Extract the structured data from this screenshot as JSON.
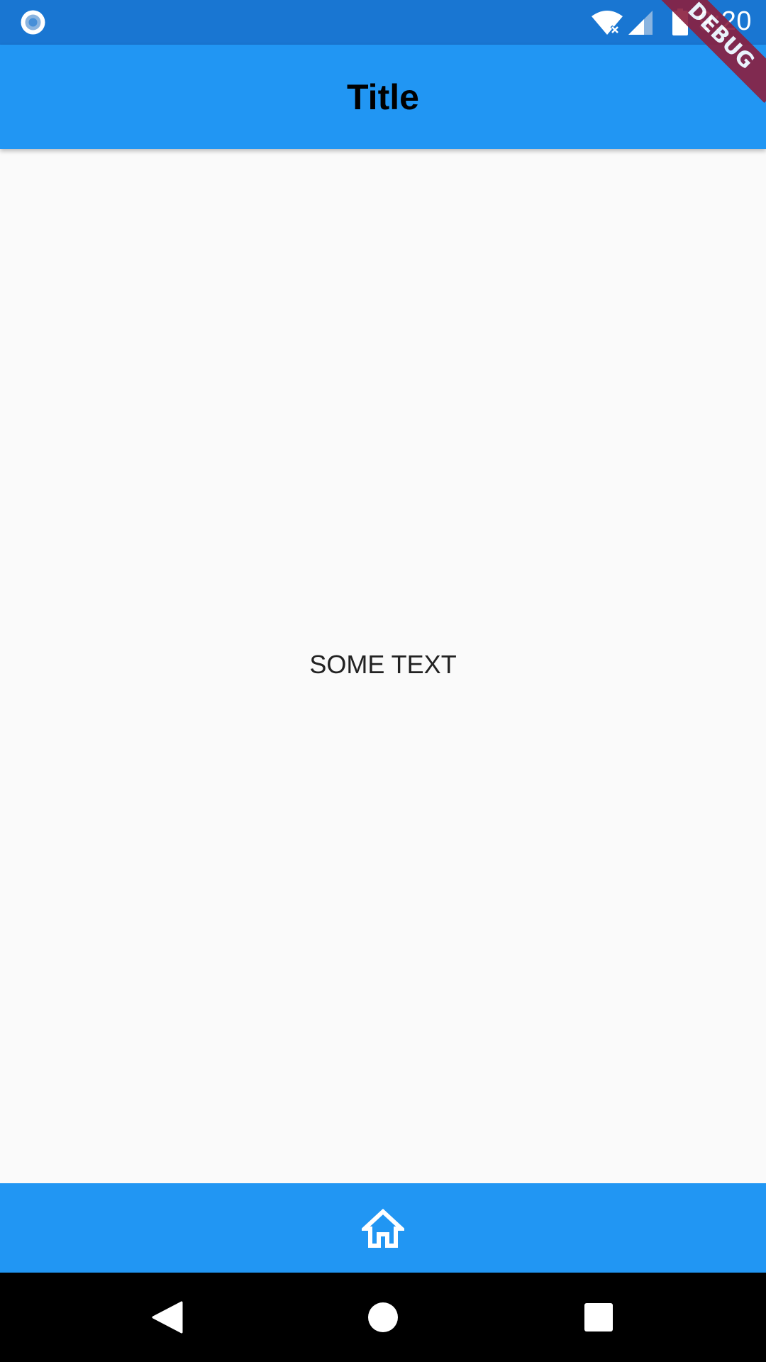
{
  "status_bar": {
    "time": "9:20",
    "icons": [
      "record-icon",
      "wifi-icon",
      "cell-signal-icon",
      "battery-icon"
    ]
  },
  "debug_banner": {
    "label": "DEBUG"
  },
  "app_bar": {
    "title": "Title"
  },
  "main": {
    "text": "SOME TEXT"
  },
  "bottom_bar": {
    "items": [
      {
        "icon": "home-icon"
      }
    ]
  },
  "nav_bar": {
    "icons": [
      "back-icon",
      "home-icon",
      "recents-icon"
    ]
  },
  "colors": {
    "status_bar": "#1976d2",
    "app_bar": "#2196f3",
    "body": "#fafafa",
    "nav_bar": "#000000",
    "debug_banner": "#8b1f3f"
  }
}
